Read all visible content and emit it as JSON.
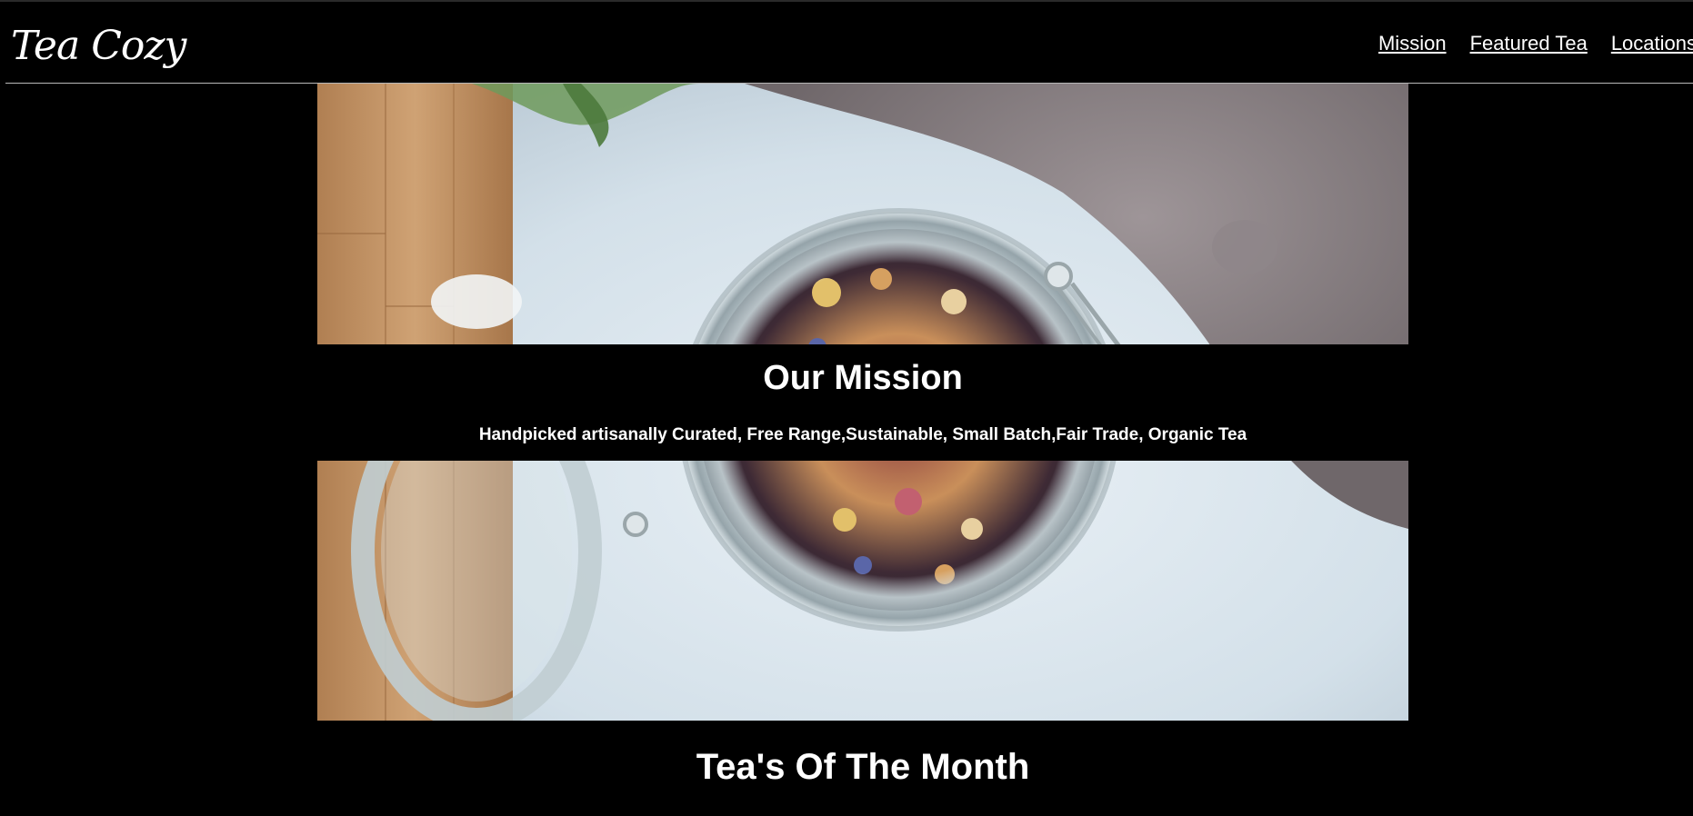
{
  "header": {
    "logo": "Tea Cozy",
    "nav": [
      "Mission",
      "Featured Tea",
      "Locations"
    ]
  },
  "hero": {
    "image": "loose-leaf-tea-jar-photo"
  },
  "mission": {
    "title": "Our Mission",
    "text": "Handpicked artisanally Curated, Free Range,Sustainable, Small Batch,Fair Trade, Organic Tea"
  },
  "featured": {
    "title": "Tea's Of The Month"
  },
  "colors": {
    "background": "#000000",
    "text": "#ffffff",
    "divider": "#b8b8b8"
  }
}
